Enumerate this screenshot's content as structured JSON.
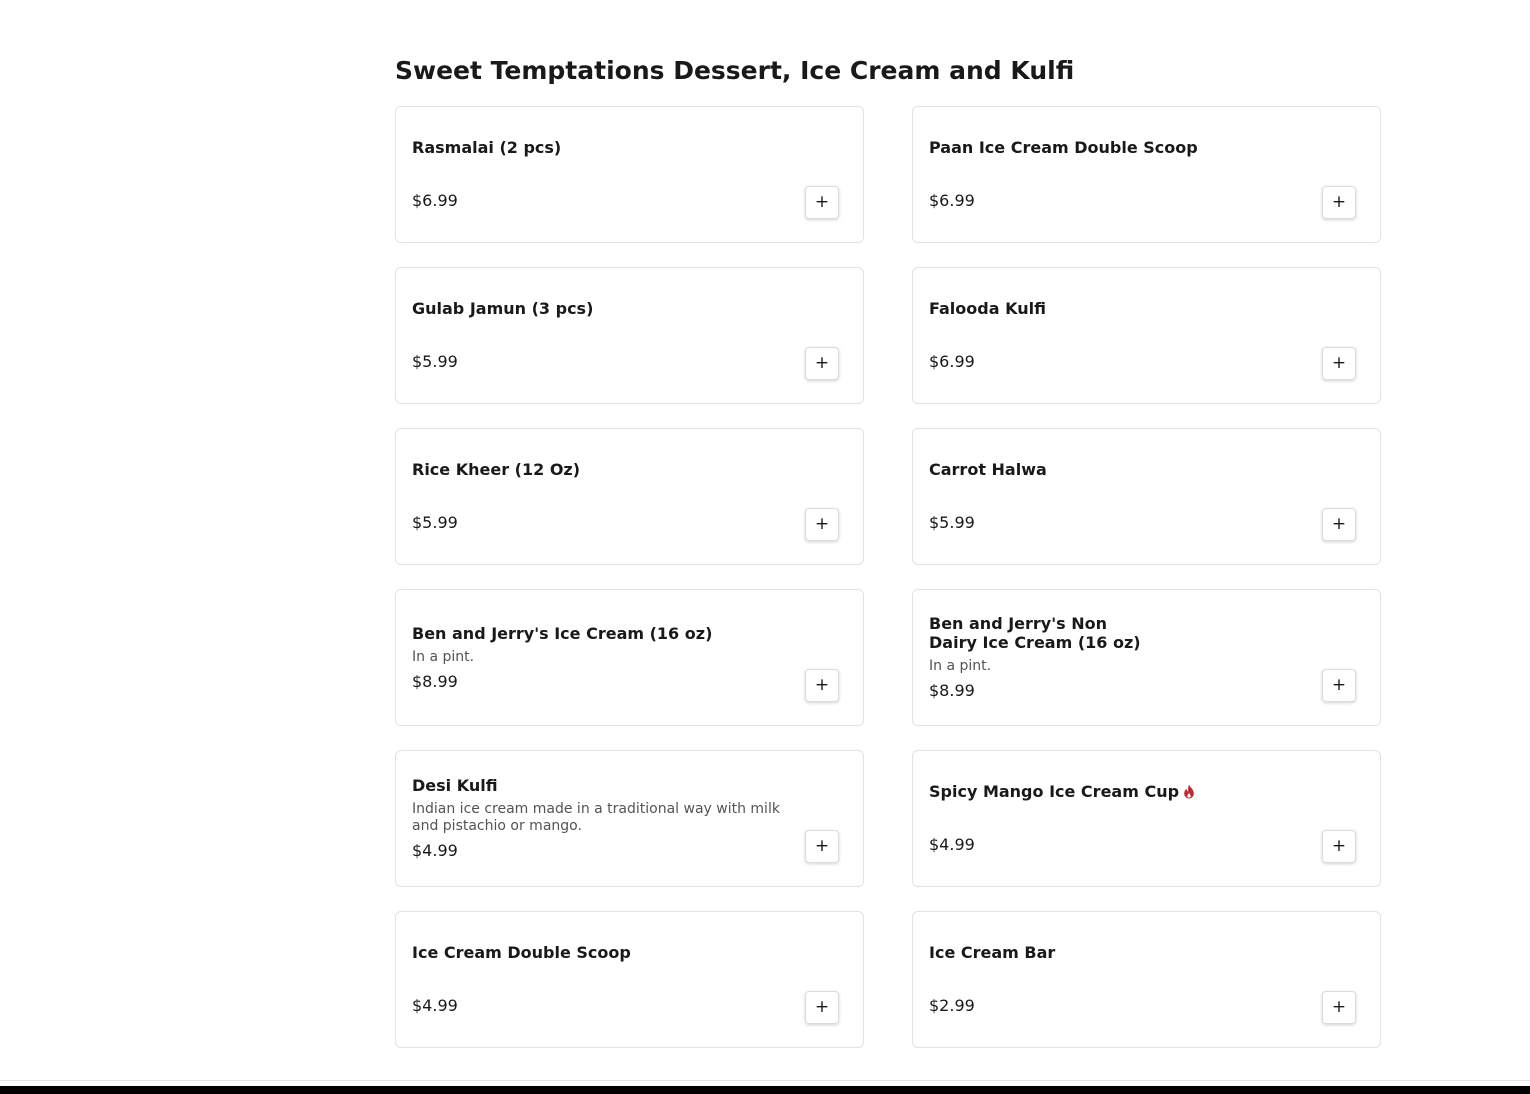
{
  "section": {
    "title": "Sweet Temptations Dessert, Ice Cream and Kulfi"
  },
  "add_button_label": "+",
  "spicy_icon_color": "#c0282d",
  "items": [
    {
      "name": "Rasmalai (2 pcs)",
      "description": "",
      "price": "$6.99",
      "spicy": false
    },
    {
      "name": "Paan Ice Cream Double Scoop",
      "description": "",
      "price": "$6.99",
      "spicy": false
    },
    {
      "name": "Gulab Jamun (3 pcs)",
      "description": "",
      "price": "$5.99",
      "spicy": false
    },
    {
      "name": "Falooda Kulfi",
      "description": "",
      "price": "$6.99",
      "spicy": false
    },
    {
      "name": "Rice Kheer (12 Oz)",
      "description": "",
      "price": "$5.99",
      "spicy": false
    },
    {
      "name": "Carrot Halwa",
      "description": "",
      "price": "$5.99",
      "spicy": false
    },
    {
      "name": "Ben and Jerry's Ice Cream (16 oz)",
      "description": "In a pint.",
      "price": "$8.99",
      "spicy": false
    },
    {
      "name": "Ben and Jerry's Non Dairy Ice Cream (16 oz)",
      "description": "In a pint.",
      "price": "$8.99",
      "spicy": false
    },
    {
      "name": "Desi Kulfi",
      "description": "Indian ice cream made in a traditional way with milk and pistachio or mango.",
      "price": "$4.99",
      "spicy": false
    },
    {
      "name": "Spicy Mango Ice Cream Cup",
      "description": "",
      "price": "$4.99",
      "spicy": true
    },
    {
      "name": "Ice Cream Double Scoop",
      "description": "",
      "price": "$4.99",
      "spicy": false
    },
    {
      "name": "Ice Cream Bar",
      "description": "",
      "price": "$2.99",
      "spicy": false
    }
  ]
}
